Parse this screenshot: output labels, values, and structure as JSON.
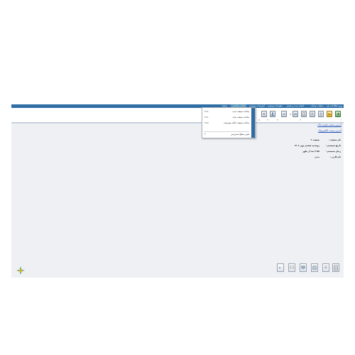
{
  "menubar": {
    "items": [
      {
        "label": "ورود اطلاعات پایه"
      },
      {
        "label": "عملیات سامانه"
      },
      {
        "label": "اضافه مدت و تعدیل"
      },
      {
        "label": "تنظیمات سیستم"
      },
      {
        "label": "گزارشات سیستم"
      },
      {
        "label": "ساخت شاخصی"
      },
      {
        "label": "راهنما"
      }
    ]
  },
  "toolbar": {
    "numbers": [
      "۱",
      "۲",
      "۳",
      "۴",
      "۵"
    ],
    "icons": [
      "tool-icon-1",
      "tool-icon-2",
      "tool-icon-3",
      "tool-icon-4",
      "tool-icon-5",
      "tool-icon-6",
      "tool-icon-7",
      "tool-icon-8",
      "tool-icon-9"
    ]
  },
  "dropdown": {
    "items": [
      {
        "label": "ساخت شیفت جدید",
        "shortcut": "F12"
      },
      {
        "label": "ساخت شیفت بیات",
        "shortcut": "F11"
      },
      {
        "label": "ساخت شیفت حالت پیشرفت",
        "shortcut": "F10"
      },
      {
        "label": "تغییر سطح دسترسی",
        "shortcut": "F"
      }
    ]
  },
  "links": {
    "website": "آدرس سایت فرابه تاک",
    "email": "آدرس پست الکترونیک"
  },
  "info": {
    "rows": [
      {
        "label": "نام شیفت :",
        "value": "شیفت ۲"
      },
      {
        "label": "تاریخ سیستم :",
        "value": "دوشنبه هشتم مهر ۱۴۰۲"
      },
      {
        "label": "زمان سیستم :",
        "value": "۲:۵۸ بعد از ظهر"
      },
      {
        "label": "نام کاربر :",
        "value": "مدیر"
      }
    ]
  },
  "colors": {
    "menubar": "#2f6fa6",
    "link": "#1f4fb4",
    "dropdown_gutter": "#2e6da4",
    "app_background": "#eef0f3"
  }
}
